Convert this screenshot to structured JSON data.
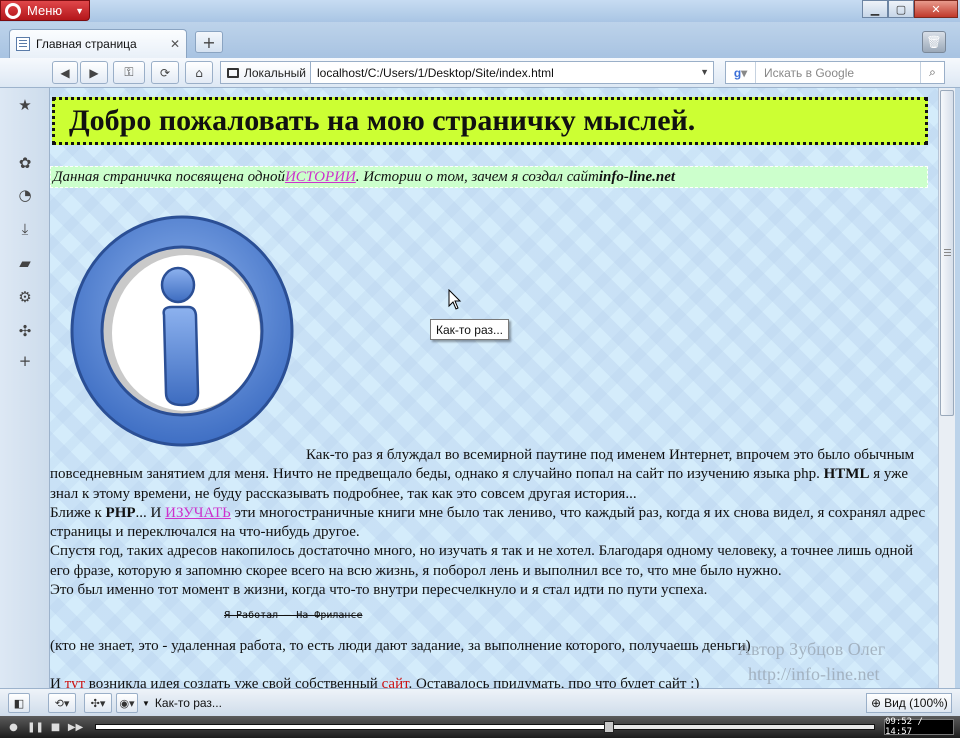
{
  "browser": {
    "menu_label": "Меню",
    "tab_title": "Главная страница",
    "address_scope": "Локальный",
    "address_url": "localhost/C:/Users/1/Desktop/Site/index.html",
    "search_placeholder": "Искать в Google",
    "zoom_label": "Вид (100%)",
    "task_label": "Как-то раз..."
  },
  "page": {
    "banner_title": "Добро пожаловать на мою страничку мыслей.",
    "intro_before": "Данная страничка посвящена одной ",
    "intro_link": "ИСТОРИИ",
    "intro_after": ". Истории о том, зачем я создал сайт ",
    "intro_site": "info-line.net",
    "tooltip": "Как-то раз...",
    "p1": "Как-то раз я блуждал во всемирной паутине под именем Интернет, впрочем это было обычным повседневным занятием для меня. Ничто не предвещало беды, однако я случайно попал на сайт по изучению языка php. ",
    "p1_bold": "HTML",
    "p1_end": " я уже знал к этому времени, не буду рассказывать подробнее, так как это совсем другая история...",
    "p2_a": "Ближе к ",
    "p2_bold": "PHP",
    "p2_b": "... И ",
    "p2_link": "ИЗУЧАТЬ",
    "p2_c": " эти многостраничные книги мне было так лениво, что каждый раз, когда я их снова видел, я сохранял адрес страницы и переключался на что-нибудь другое.",
    "p3": "Спустя год, таких адресов накопилось достаточно много, но изучать я так и не хотел. Благодаря одному человеку, а точнее лишь одной его фразе, которую я запомню скорее всего на всю жизнь, я поборол лень и выполнил все то, что мне было нужно.",
    "p4": "Это был именно тот момент в жизни, когда что-то внутри пересчелкнуло и я стал идти по пути успеха.",
    "strike_text": "Я Работал — На Фрилансе",
    "p5": "(кто не знает, это - удаленная работа, то есть люди дают задание, за выполнение которого, получаешь деньги)",
    "p6_a": "И ",
    "p6_red1": "тут",
    "p6_b": " возникла идея создать уже свой собственный ",
    "p6_red2": "сайт",
    "p6_c": ". Оставалось придумать, про что будет сайт :)"
  },
  "watermark": {
    "author": "Автор Зубцов Олег",
    "url": "http://info-line.net"
  },
  "media": {
    "time": "09:52 / 14:57",
    "progress": 0.66
  },
  "colors": {
    "banner_bg": "#ccff33",
    "intro_bg": "#ccffcc",
    "link_magenta": "#cc33cc",
    "red_text": "#cc1111",
    "menu_red": "#c0272d"
  }
}
